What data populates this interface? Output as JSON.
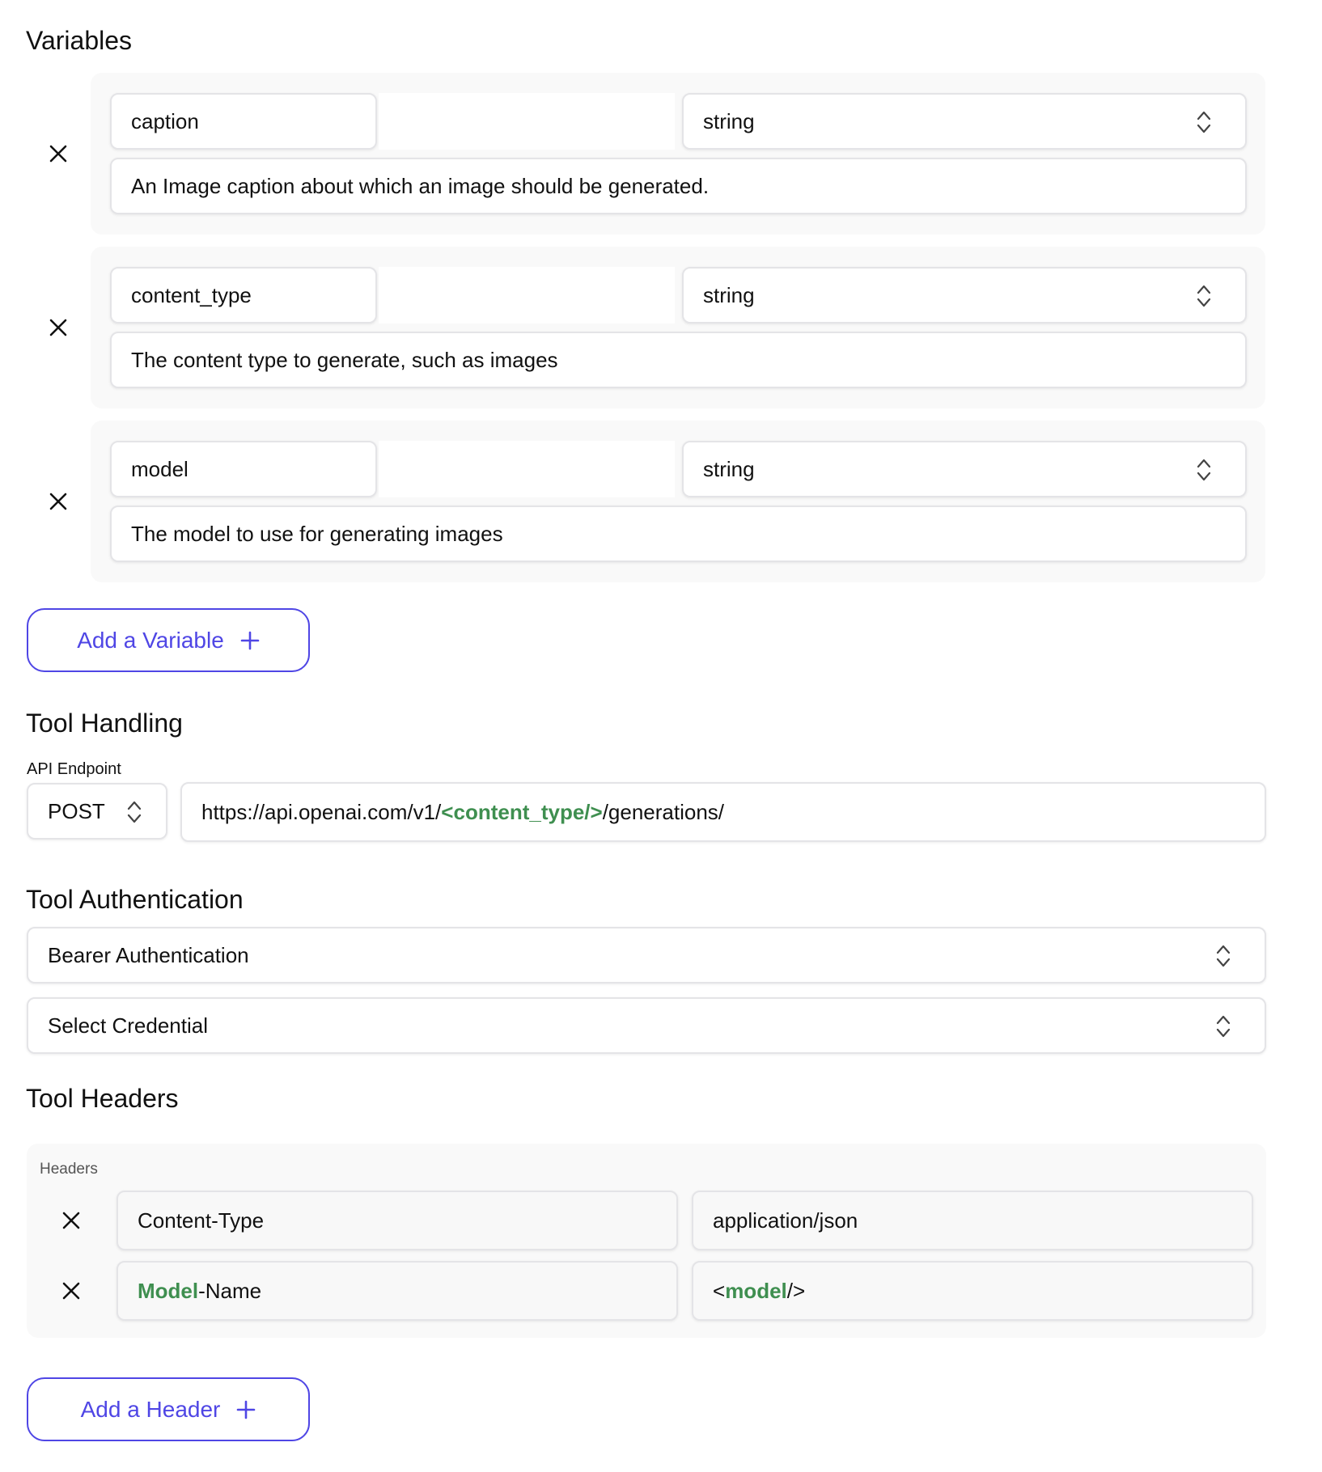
{
  "variables_section": {
    "title": "Variables",
    "items": [
      {
        "name": "caption",
        "type": "string",
        "description": "An Image caption about which an image should be generated."
      },
      {
        "name": "content_type",
        "type": "string",
        "description": "The content type to generate, such as images"
      },
      {
        "name": "model",
        "type": "string",
        "description": "The model to use for generating images"
      }
    ],
    "add_button_label": "Add a Variable"
  },
  "tool_handling": {
    "title": "Tool Handling",
    "endpoint_label": "API Endpoint",
    "method": "POST",
    "url_prefix": "https://api.openai.com/v1/",
    "url_variable": "<content_type/>",
    "url_suffix": "/generations/"
  },
  "tool_authentication": {
    "title": "Tool Authentication",
    "auth_type": "Bearer Authentication",
    "credential_placeholder": "Select Credential"
  },
  "tool_headers": {
    "title": "Tool Headers",
    "card_label": "Headers",
    "rows": [
      {
        "key_plain": "Content-Type",
        "value_plain": "application/json"
      },
      {
        "key_var": "Model",
        "key_rest": "-Name",
        "value_open": "<",
        "value_var": "model",
        "value_close": "/>"
      }
    ],
    "add_button_label": "Add a Header"
  },
  "colors": {
    "accent": "#4f46e5",
    "variable_highlight": "#3f8f50",
    "card_background": "#f9f9f9",
    "field_border": "#e4e4e7"
  },
  "icons": {
    "remove": "close-icon",
    "select": "chevron-up-down-icon",
    "add": "plus-icon"
  }
}
